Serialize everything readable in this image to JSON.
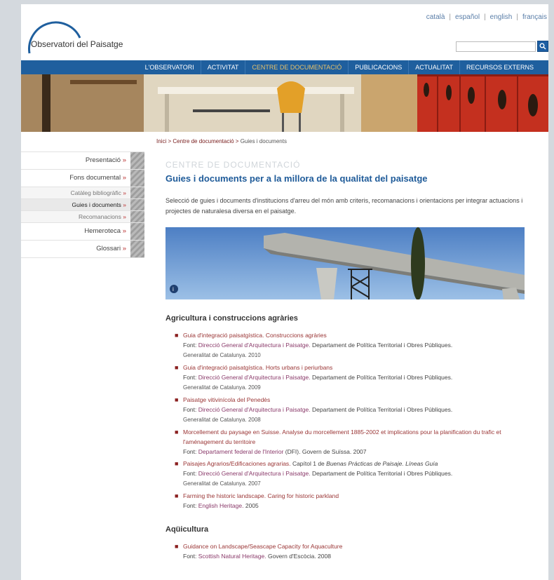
{
  "header": {
    "logo_text": "Observatori del Paisatge",
    "languages": [
      "català",
      "español",
      "english",
      "français"
    ]
  },
  "nav": {
    "items": [
      "L'OBSERVATORI",
      "ACTIVITAT",
      "CENTRE DE DOCUMENTACIÓ",
      "PUBLICACIONS",
      "ACTUALITAT",
      "RECURSOS EXTERNS"
    ],
    "active_index": 2
  },
  "breadcrumb": {
    "home": "Inici",
    "section": "Centre de documentació",
    "current": "Guies i documents",
    "separator": ">"
  },
  "sidebar": {
    "items": [
      {
        "label": "Presentació",
        "arrow": "»",
        "sub": false
      },
      {
        "label": "Fons documental",
        "arrow": "»",
        "sub": false
      },
      {
        "label": "Catàleg bibliogràfic",
        "arrow": "»",
        "sub": true
      },
      {
        "label": "Guies i documents",
        "arrow": "»",
        "sub": true,
        "active": true
      },
      {
        "label": "Recomanacions",
        "arrow": "»",
        "sub": true
      },
      {
        "label": "Hemeroteca",
        "arrow": "»",
        "sub": false
      },
      {
        "label": "Glossari",
        "arrow": "»",
        "sub": false
      }
    ]
  },
  "content": {
    "section_title": "CENTRE DE DOCUMENTACIÓ",
    "page_title": "Guies i documents per a la millora de la qualitat del paisatge",
    "intro": "Selecció de guies i documents d'institucions d'arreu del món amb criteris, recomanacions i orientacions per integrar actuacions i projectes de naturalesa diversa en el paisatge.",
    "categories": [
      {
        "title": "Agricultura i construccions agràries",
        "docs": [
          {
            "title": "Guia d'integració paisatgística. Construccions agràries",
            "font_label": "Font:",
            "source": "Direcció General d'Arquitectura i Paisatge.",
            "rest": "Departament de Política Territorial i Obres Públiques.",
            "line3": "Generalitat de Catalunya. 2010"
          },
          {
            "title": "Guia d'integració paisatgística. Horts urbans i periurbans",
            "font_label": "Font:",
            "source": "Direcció General d'Arquitectura i Paisatge.",
            "rest": "Departament de Política Territorial i Obres Públiques.",
            "line3": "Generalitat de Catalunya. 2009"
          },
          {
            "title": "Paisatge vitivinícola del Penedès",
            "font_label": "Font:",
            "source": "Direcció General d'Arquitectura i Paisatge.",
            "rest": "Departament de Política Territorial i Obres Públiques.",
            "line3": "Generalitat de Catalunya. 2008"
          },
          {
            "title": "Morcellement du paysage en Suisse. Analyse du morcellement 1885-2002 et implications pour la planification du trafic et l'aménagement du territoire",
            "font_label": "Font:",
            "source": "Departament federal de l'Interior",
            "rest": "(DFI). Govern de Suïssa. 2007",
            "line3": ""
          },
          {
            "title": "Paisajes Agrarios/Edificaciones agrarias.",
            "title_extra": "Capítol 1 de",
            "title_italic": "Buenas Prácticas de Paisaje. Líneas Guía",
            "font_label": "Font:",
            "source": "Direcció General d'Arquitectura i Paisatge.",
            "rest": "Departament de Política Territorial i Obres Públiques.",
            "line3": "Generalitat de Catalunya. 2007"
          },
          {
            "title": "Farming the historic landscape. Caring for historic parkland",
            "font_label": "Font:",
            "source": "English Heritage.",
            "rest": "2005",
            "line3": ""
          }
        ]
      },
      {
        "title": "Aqüicultura",
        "docs": [
          {
            "title": "Guidance on Landscape/Seascape Capacity for Aquaculture",
            "font_label": "Font:",
            "source": "Scottish Natural Heritage.",
            "rest": "Govern d'Escòcia. 2008",
            "line3": ""
          }
        ]
      }
    ]
  },
  "colors": {
    "nav_bg": "#1f5f9e",
    "nav_active": "#e6c16a",
    "title_blue": "#1f5b99",
    "link_red": "#9a3535"
  }
}
